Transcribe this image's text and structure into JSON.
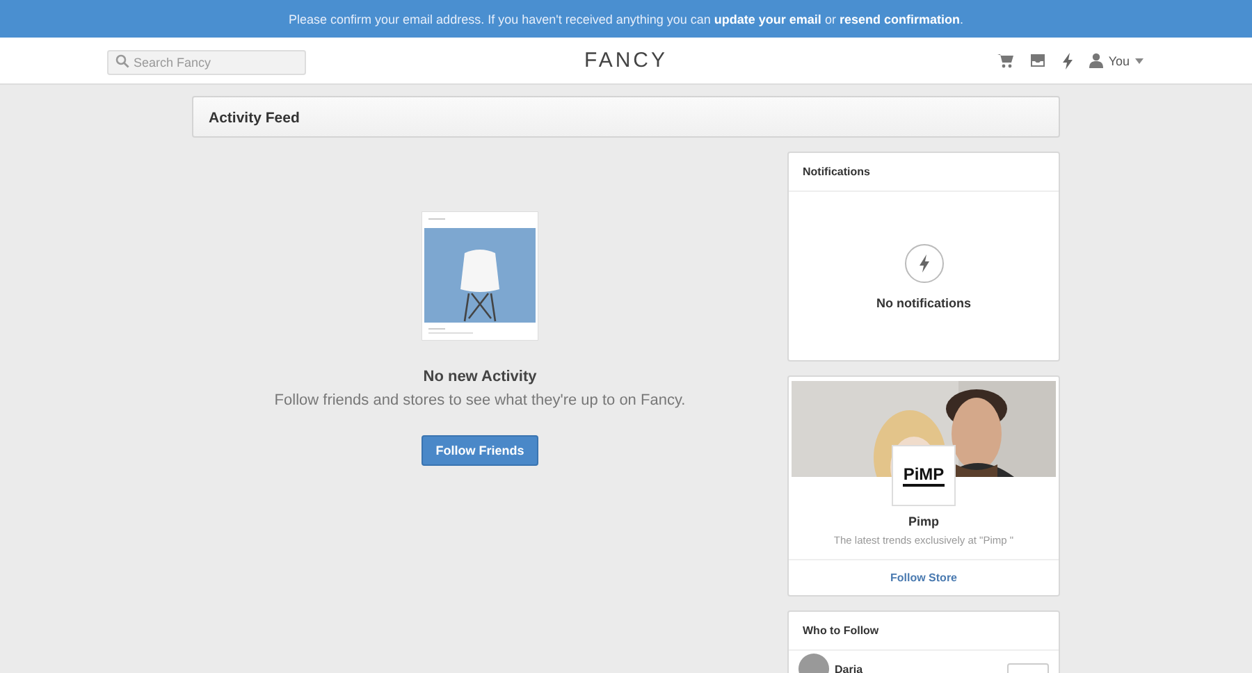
{
  "banner": {
    "text": "Please confirm your email address. If you haven't received anything you can **update your email** or **resend confirmation**."
  },
  "header": {
    "search": {
      "placeholder": "Search Fancy"
    },
    "logo": "FANCY",
    "user": "You"
  },
  "feed": {
    "title": "Activity Feed",
    "empty_title": "No new Activity",
    "empty_text": "Follow friends and stores to see what they're up to on Fancy.",
    "button": "Follow Friends"
  },
  "notifications": {
    "title": "Notifications",
    "empty": "No notifications"
  },
  "store": {
    "logo_text": "PiMP",
    "name": "Pimp",
    "tagline": "The latest trends exclusively at \"Pimp \"",
    "button": "Follow Store"
  },
  "who_to_follow": {
    "title": "Who to Follow",
    "people": [
      {
        "name": "Daria"
      }
    ]
  }
}
